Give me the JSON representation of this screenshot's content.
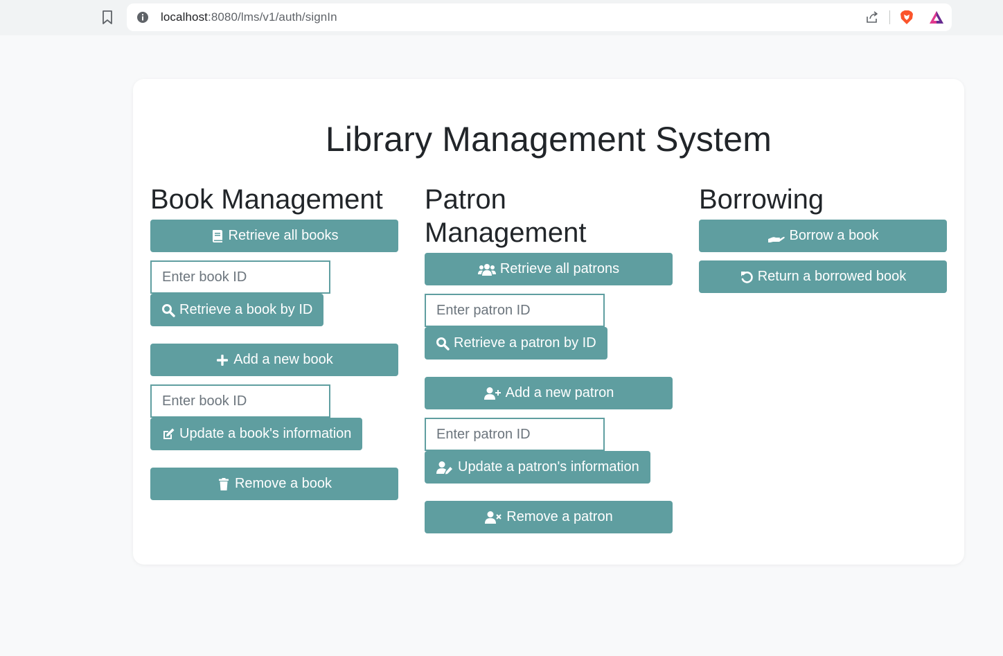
{
  "browser": {
    "url_host": "localhost",
    "url_rest": ":8080/lms/v1/auth/signIn"
  },
  "page": {
    "title": "Library Management System"
  },
  "book_management": {
    "heading": "Book Management",
    "retrieve_all": "Retrieve all books",
    "id_placeholder_1": "Enter book ID",
    "retrieve_by_id": "Retrieve a book by ID",
    "add_new": "Add a new book",
    "id_placeholder_2": "Enter book ID",
    "update": "Update a book's information",
    "remove": "Remove a book"
  },
  "patron_management": {
    "heading": "Patron Management",
    "retrieve_all": "Retrieve all patrons",
    "id_placeholder_1": "Enter patron ID",
    "retrieve_by_id": "Retrieve a patron by ID",
    "add_new": "Add a new patron",
    "id_placeholder_2": "Enter patron ID",
    "update": "Update a patron's information",
    "remove": "Remove a patron"
  },
  "borrowing": {
    "heading": "Borrowing",
    "borrow": "Borrow a book",
    "return": "Return a borrowed book"
  },
  "colors": {
    "accent": "#5f9ea0",
    "background": "#f8f9fa",
    "card": "#ffffff"
  }
}
